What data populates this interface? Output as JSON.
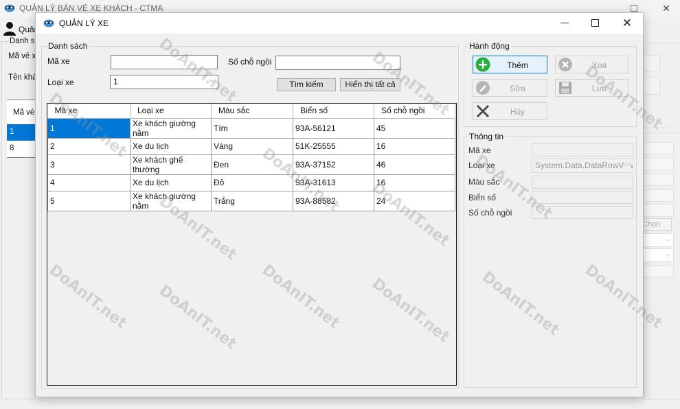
{
  "background_window": {
    "title": "QUẢN LÝ BÁN VÉ XE KHÁCH - CTMA",
    "user_label": "Quản",
    "group_label": "Danh sá",
    "label_ma_ve": "Mã vé xe",
    "label_ten_kh": "Tên khá",
    "grid_header": "Mã vé",
    "grid_rows": [
      "1",
      "8"
    ],
    "button_chon": "Chọn"
  },
  "dialog": {
    "title": "QUẢN LÝ XE",
    "danh_sach": {
      "group_label": "Danh sách",
      "label_ma_xe": "Mã xe",
      "input_ma_xe": "",
      "label_so_cho_ngoi": "Số chỗ ngồi",
      "input_so_cho_ngoi": "",
      "label_loai_xe": "Loại xe",
      "combo_loai_xe": "1",
      "btn_tim_kiem": "Tìm kiếm",
      "btn_hien_thi_tat_ca": "Hiển thị tất cả"
    },
    "grid": {
      "columns": [
        "Mã xe",
        "Loại xe",
        "Màu sắc",
        "Biển số",
        "Số chỗ ngồi"
      ],
      "rows": [
        [
          "1",
          "Xe khách giường nằm",
          "Tím",
          "93A-56121",
          "45"
        ],
        [
          "2",
          "Xe du lịch",
          "Vàng",
          "51K-25555",
          "16"
        ],
        [
          "3",
          "Xe khách ghế thường",
          "Đen",
          "93A-37152",
          "46"
        ],
        [
          "4",
          "Xe du lịch",
          "Đỏ",
          "93A-31613",
          "16"
        ],
        [
          "5",
          "Xe khách giường nằm",
          "Trắng",
          "93A-88582",
          "24"
        ]
      ]
    },
    "hanh_dong": {
      "group_label": "Hành động",
      "btn_them": "Thêm",
      "btn_xoa": "Xóa",
      "btn_sua": "Sửa",
      "btn_luu": "Lưu",
      "btn_huy": "Hủy"
    },
    "thong_tin": {
      "group_label": "Thông tin",
      "label_ma_xe": "Mã xe",
      "label_loai_xe": "Loại xe",
      "combo_loai_xe": "System.Data.DataRowView",
      "label_mau_sac": "Màu sắc",
      "label_bien_so": "Biển số",
      "label_so_cho_ngoi": "Số chỗ ngồi"
    }
  },
  "watermark": "DoAnIT.net",
  "colors": {
    "selection": "#0078d7",
    "add_icon_green": "#27ae3b",
    "disabled_gray": "#a0a0a0"
  }
}
